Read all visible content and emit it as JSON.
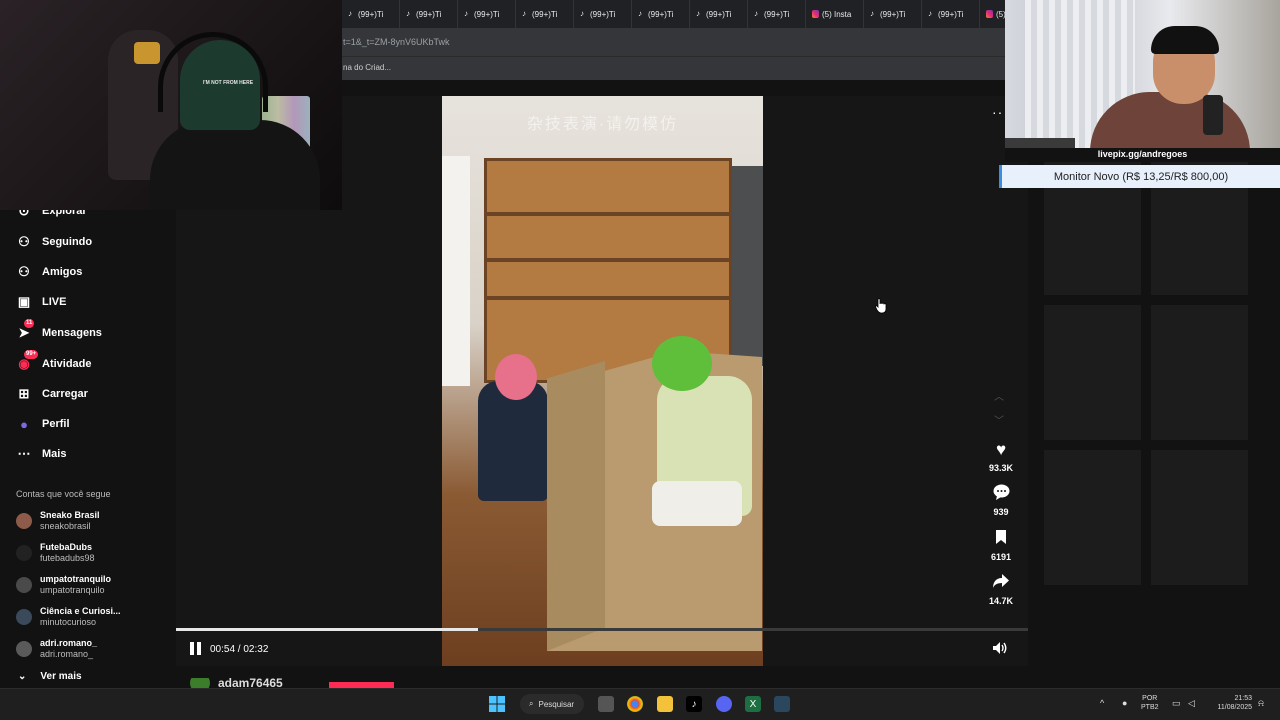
{
  "browser": {
    "tabs": [
      {
        "label": "(99+)Ti",
        "icon": "tiktok-icon"
      },
      {
        "label": "(99+)Ti",
        "icon": "tiktok-icon"
      },
      {
        "label": "(99+)Ti",
        "icon": "tiktok-icon"
      },
      {
        "label": "(99+)Ti",
        "icon": "tiktok-icon"
      },
      {
        "label": "(99+)Ti",
        "icon": "tiktok-icon"
      },
      {
        "label": "(99+)Ti",
        "icon": "tiktok-icon"
      },
      {
        "label": "(99+)Ti",
        "icon": "tiktok-icon"
      },
      {
        "label": "(99+)Ti",
        "icon": "tiktok-icon"
      },
      {
        "label": "(5) Insta",
        "icon": "instagram-icon"
      },
      {
        "label": "(99+)Ti",
        "icon": "tiktok-icon"
      },
      {
        "label": "(99+)Ti",
        "icon": "tiktok-icon"
      },
      {
        "label": "(5) Inst",
        "icon": "instagram-icon"
      }
    ],
    "url_fragment": "t=1&_t=ZM-8ynV6UKbTwk",
    "bookmark": "na do Criad..."
  },
  "stream_overlay": {
    "donation_url": "livepix.gg/andregoes",
    "goal": "Monitor Novo (R$ 13,25/R$ 800,00)",
    "cap_text": "I'M NOT FROM HERE"
  },
  "sidebar": {
    "nav": [
      {
        "label": "Explorar",
        "icon": "compass-icon"
      },
      {
        "label": "Seguindo",
        "icon": "user-follow-icon"
      },
      {
        "label": "Amigos",
        "icon": "friends-icon"
      },
      {
        "label": "LIVE",
        "icon": "live-icon"
      },
      {
        "label": "Mensagens",
        "icon": "messages-icon",
        "badge": "11"
      },
      {
        "label": "Atividade",
        "icon": "activity-icon",
        "badge": "99+"
      },
      {
        "label": "Carregar",
        "icon": "upload-icon"
      },
      {
        "label": "Perfil",
        "icon": "profile-icon"
      },
      {
        "label": "Mais",
        "icon": "more-icon"
      }
    ],
    "following_title": "Contas que você segue",
    "accounts": [
      {
        "name": "Sneako Brasil",
        "user": "sneakobrasil",
        "color": "#8e5a4a"
      },
      {
        "name": "FutebaDubs",
        "user": "futebadubs98",
        "color": "#222222"
      },
      {
        "name": "umpatotranquilo",
        "user": "umpatotranquilo",
        "color": "#4a4a4a"
      },
      {
        "name": "Ciência e Curiosi...",
        "user": "minutocurioso",
        "color": "#3a4a5a"
      },
      {
        "name": "adri.romano_",
        "user": "adri.romano_",
        "color": "#5a5a5a"
      }
    ],
    "see_more": "Ver mais"
  },
  "video": {
    "watermark": "杂技表演·请勿模仿",
    "time": "00:54 / 02:32",
    "progress": 0.355,
    "likes": "93.3K",
    "comments": "939",
    "saves": "6191",
    "shares": "14.7K",
    "author": "adam76465"
  },
  "taskbar": {
    "search": "Pesquisar",
    "lang1": "POR",
    "lang2": "PTB2",
    "time": "21:53",
    "date": "11/08/2025"
  }
}
